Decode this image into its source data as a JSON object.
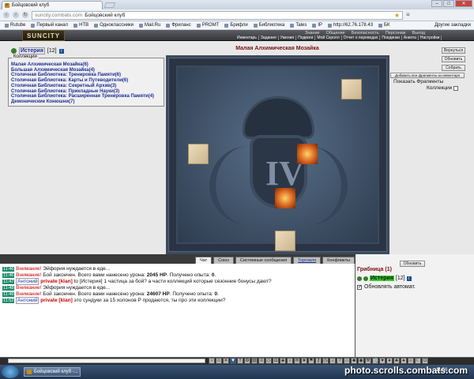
{
  "browser": {
    "tab_title": "Бойцовский клуб",
    "url_domain": "suncity.combats.com",
    "page_title": "Бойцовский клуб",
    "bookmarks": [
      "Rutube",
      "Первый канал",
      "НТВ",
      "Одноклассники",
      "Mail.Ru",
      "Фриланс",
      "PROMT",
      "Брифли",
      "Библиотека",
      "Tales",
      "IP",
      "http://62.76.178.43",
      "БК"
    ],
    "other_bookmarks": "Другие закладки"
  },
  "header": {
    "logo": "SUNCITY",
    "top_menu": [
      "Знание",
      "Общение",
      "Безопасность",
      "Персонаж",
      "Выход"
    ],
    "sub_menu": [
      "Инвентарь",
      "Задания",
      "Умения",
      "Подвиги",
      "Мой Скролл",
      "Отчет о переводах",
      "Поединки",
      "Анкета",
      "Настройки"
    ]
  },
  "player": {
    "name": "Истерия",
    "level": "[12]"
  },
  "collections": {
    "header": "Коллекции",
    "items": [
      "Малая Алхимическая Мозайка(6)",
      "Большая Алхимическая Мозайка(4)",
      "Столичная Библиотека: Тренировка Памяти(6)",
      "Столичная Библиотека: Карты и Путеводители(6)",
      "Столичная Библиотека: Секретный Архив(3)",
      "Столичная Библиотека: Прикладные Науки(3)",
      "Столичная Библиотека: Расширенная Тренировка Памяти(4)",
      "Демонические Конюшни(7)"
    ]
  },
  "mosaic": {
    "title": "Малая Алхимическая Мозайка",
    "roman": "IV"
  },
  "right_buttons": [
    "Вернуться",
    "Обновить",
    "Собрать"
  ],
  "add_all_button": "Добавить все фрагменты из инвентаря",
  "show_fragments": "Показать Фрагменты",
  "collections_label": "Коллекции",
  "chat_tabs": [
    "Чат",
    "Союз",
    "Системные сообщения",
    "Торговля",
    "Конфликты"
  ],
  "chat_lines": [
    {
      "time": "11:46",
      "tag": "Внимание!",
      "text": "Эйфория нуждается в еде..."
    },
    {
      "time": "11:46",
      "tag": "Внимание!",
      "text": "Бой закончен. Всего вами нанесено урона:",
      "dmg": "2045 HP",
      "exp_label": "Получено опыта:",
      "exp": "0"
    },
    {
      "time": "11:47",
      "user": "Антоний",
      "priv": "private [klan]",
      "text": "to [Истерия] 1 частица за бой? а части коллекций которые сезонние бонусы дают?"
    },
    {
      "time": "11:48",
      "tag": "Внимание!",
      "text": "Эйфория нуждается в еде..."
    },
    {
      "time": "11:49",
      "tag": "Внимание!",
      "text": "Бой закончен. Всего вами нанесено урона:",
      "dmg": "24607 HP",
      "exp_label": "Получено опыта:",
      "exp": "0"
    },
    {
      "time": "11:52",
      "user": "Антоний",
      "priv": "private [klan]",
      "text": "это сундуки за 15 холонов Р продаются, ты про эти коллекции?"
    }
  ],
  "right_panel": {
    "update_button": "Обновить",
    "location": "Грибница (1)",
    "user": "Истерия",
    "user_level": "[12]",
    "auto_update": "Обновлять автомат."
  },
  "taskbar": {
    "button": "Бойцовский клуб -...",
    "clock": "11:56"
  },
  "watermark": "photo.scrolls.combats.com"
}
